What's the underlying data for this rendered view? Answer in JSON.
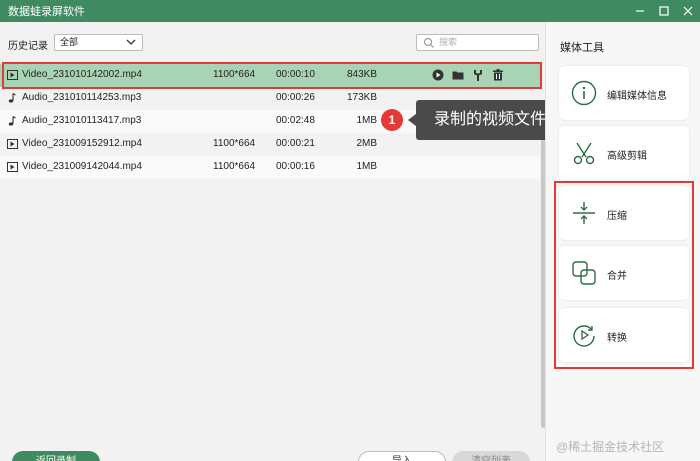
{
  "window": {
    "title": "数据蛙录屏软件",
    "controls": [
      "minimize-icon",
      "maximize-icon",
      "close-icon"
    ]
  },
  "history": {
    "label": "历史记录",
    "filter_value": "全部",
    "search_placeholder": "搜索"
  },
  "files": [
    {
      "name": "Video_231010142002.mp4",
      "type": "video",
      "resolution": "1100*664",
      "duration": "00:00:10",
      "size": "843KB",
      "selected": true
    },
    {
      "name": "Audio_231010114253.mp3",
      "type": "audio",
      "resolution": "",
      "duration": "00:00:26",
      "size": "173KB",
      "selected": false
    },
    {
      "name": "Audio_231010113417.mp3",
      "type": "audio",
      "resolution": "",
      "duration": "00:02:48",
      "size": "1MB",
      "selected": false
    },
    {
      "name": "Video_231009152912.mp4",
      "type": "video",
      "resolution": "1100*664",
      "duration": "00:00:21",
      "size": "2MB",
      "selected": false
    },
    {
      "name": "Video_231009142044.mp4",
      "type": "video",
      "resolution": "1100*664",
      "duration": "00:00:16",
      "size": "1MB",
      "selected": false
    }
  ],
  "row_actions": [
    "play-icon",
    "folder-icon",
    "trim-icon",
    "delete-icon"
  ],
  "annotation": {
    "number": "1",
    "text": "录制的视频文件"
  },
  "footer": {
    "back": "返回录制",
    "import": "导入",
    "clear": "清空列表"
  },
  "media_tools": {
    "title": "媒体工具",
    "items": [
      {
        "label": "编辑媒体信息",
        "icon": "info-icon"
      },
      {
        "label": "高级剪辑",
        "icon": "scissors-icon"
      },
      {
        "label": "压缩",
        "icon": "compress-icon"
      },
      {
        "label": "合并",
        "icon": "merge-icon"
      },
      {
        "label": "转换",
        "icon": "convert-icon"
      }
    ]
  },
  "watermark": "@稀土掘金技术社区",
  "colors": {
    "brand": "#3f8a60",
    "selected_row": "#a9d3b5",
    "highlight": "#e03a3a"
  }
}
